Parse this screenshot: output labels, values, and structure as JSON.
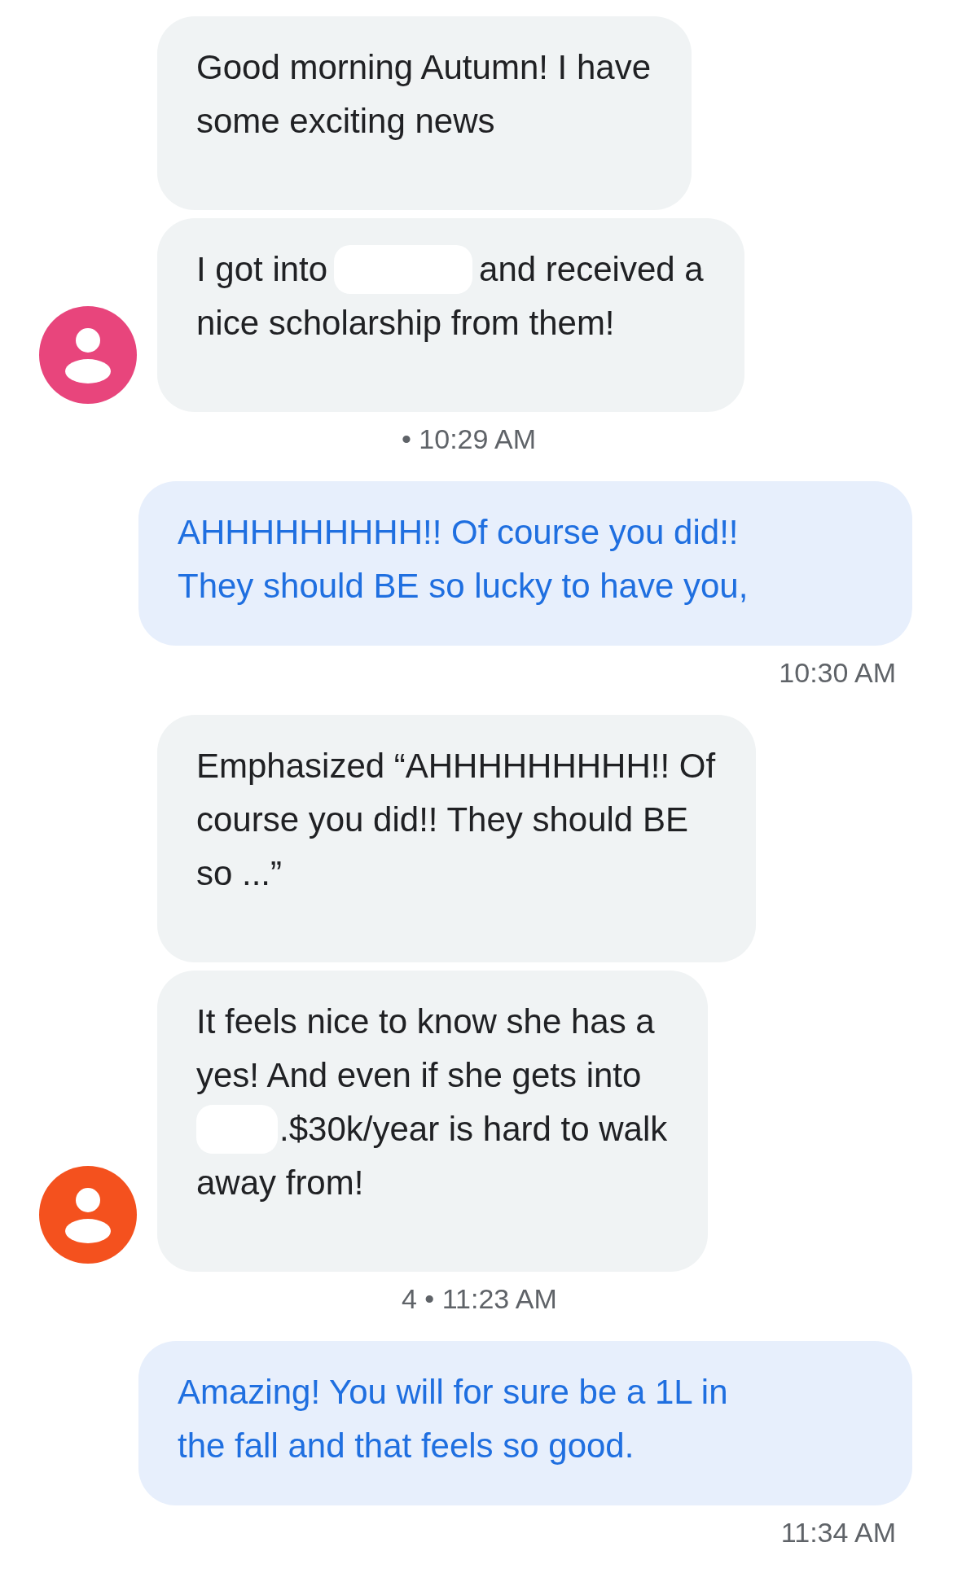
{
  "messages": [
    {
      "kind": "incoming",
      "color": "#e8457c",
      "bubbles": [
        {
          "lines": [
            {
              "parts": [
                "Good morning Autumn! I have"
              ]
            },
            {
              "parts": [
                "some exciting news"
              ]
            }
          ]
        },
        {
          "lines": [
            {
              "parts": [
                "I got into",
                "and received a"
              ]
            },
            {
              "parts": [
                "nice scholarship from them!"
              ]
            }
          ]
        }
      ],
      "meta": "• 10:29 AM"
    },
    {
      "kind": "outgoing",
      "bubbles": [
        {
          "lines": [
            {
              "parts": [
                "AHHHHHHHHH!! Of course you did!!"
              ]
            },
            {
              "parts": [
                "They should BE so lucky to have you,"
              ]
            }
          ]
        }
      ],
      "meta": "10:30 AM"
    },
    {
      "kind": "incoming",
      "color": "#f4511e",
      "bubbles": [
        {
          "lines": [
            {
              "parts": [
                "Emphasized “AHHHHHHHHH!! Of"
              ]
            },
            {
              "parts": [
                "course you did!! They should BE"
              ]
            },
            {
              "parts": [
                "so ...”"
              ]
            }
          ]
        },
        {
          "lines": [
            {
              "parts": [
                "It feels nice to know she has a"
              ]
            },
            {
              "parts": [
                "yes! And even if she gets into"
              ]
            },
            {
              "parts": [
                ".$30k/year is hard to walk"
              ],
              "redacted_start": true
            },
            {
              "parts": [
                "away from!"
              ]
            }
          ]
        }
      ],
      "meta": "4 • 11:23 AM"
    },
    {
      "kind": "outgoing",
      "bubbles": [
        {
          "lines": [
            {
              "parts": [
                "Amazing! You will for sure be a 1L in"
              ]
            },
            {
              "parts": [
                "the fall and that feels so good."
              ]
            }
          ]
        }
      ],
      "meta": "11:34 AM"
    }
  ]
}
